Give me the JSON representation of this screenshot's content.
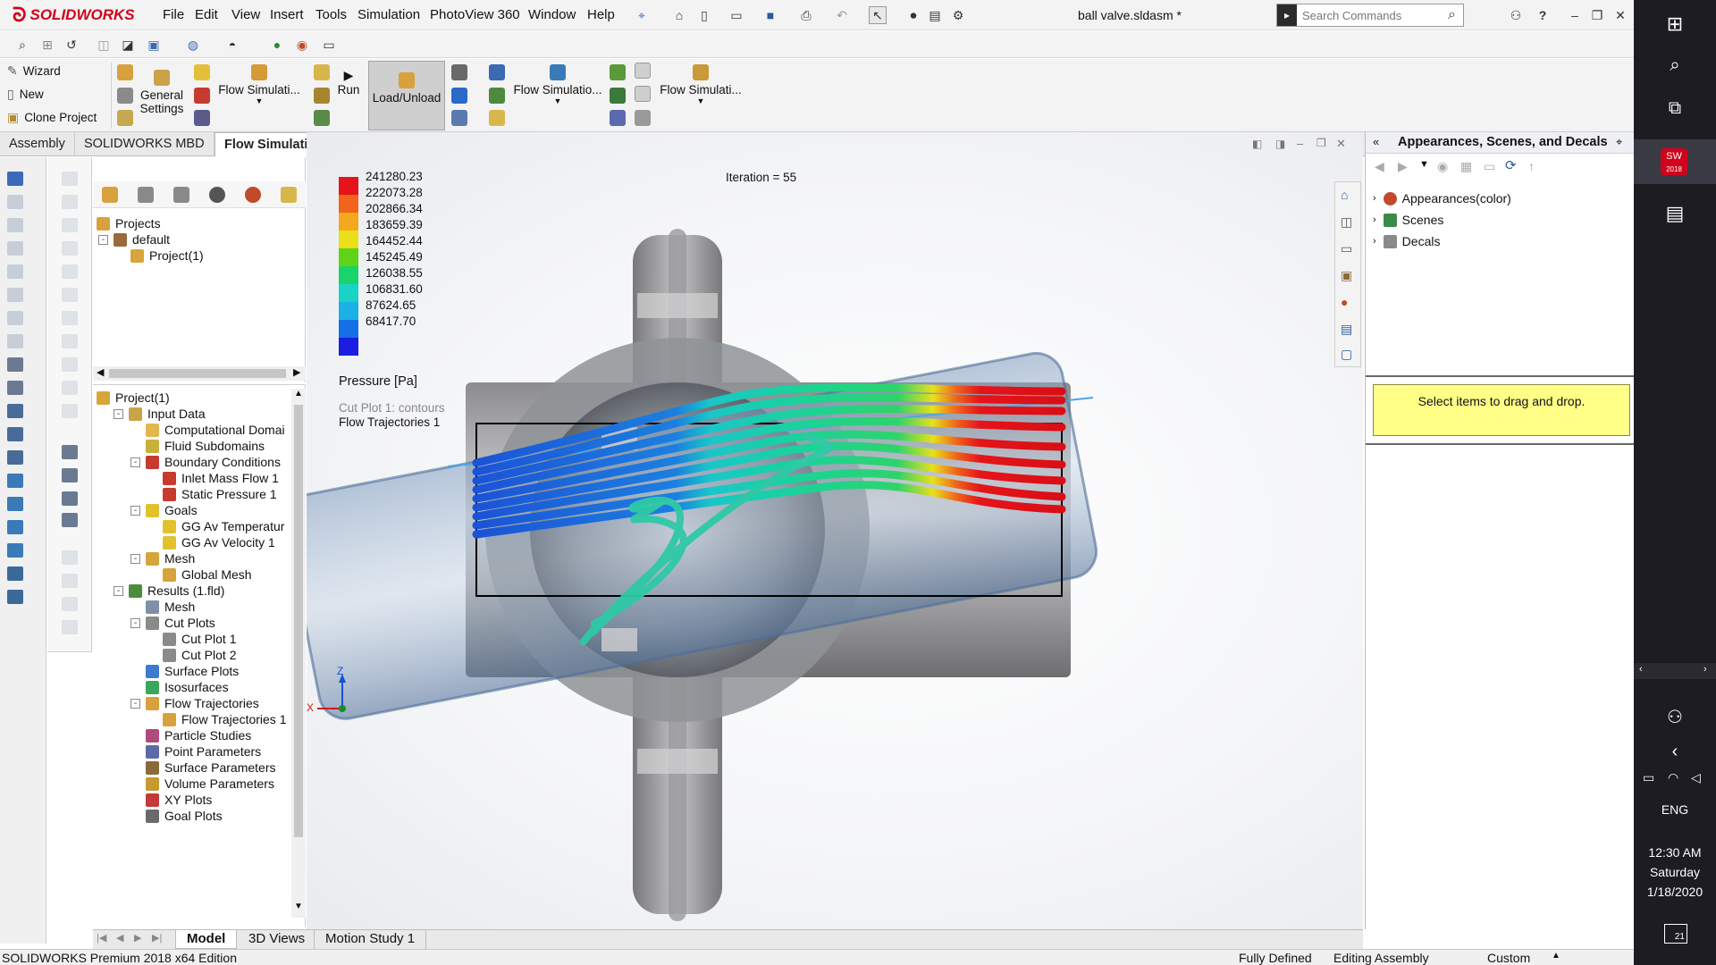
{
  "app": {
    "brand": "SOLIDWORKS",
    "document_title": "ball valve.sldasm *"
  },
  "menu": [
    "File",
    "Edit",
    "View",
    "Insert",
    "Tools",
    "Simulation",
    "PhotoView 360",
    "Window",
    "Help"
  ],
  "search": {
    "placeholder": "Search Commands"
  },
  "command_manager": {
    "wizard": "Wizard",
    "new": "New",
    "clone_project": "Clone Project",
    "general_settings": [
      "General",
      "Settings"
    ],
    "flow_sim_1": "Flow Simulati...",
    "run": "Run",
    "load_unload": "Load/Unload",
    "flow_sim_2": "Flow Simulatio...",
    "flow_sim_3": "Flow Simulati..."
  },
  "tabs": [
    "Assembly",
    "SOLIDWORKS MBD",
    "Flow Simulation"
  ],
  "active_tab": "Flow Simulation",
  "projects_tree": {
    "root": "Projects",
    "config": "default",
    "project": "Project(1)"
  },
  "analysis_tree": [
    {
      "label": "Project(1)",
      "level": 0,
      "exp": "",
      "icon": "#d8a53a"
    },
    {
      "label": "Input Data",
      "level": 1,
      "exp": "-",
      "icon": "#c9a34a"
    },
    {
      "label": "Computational Domai",
      "level": 2,
      "exp": "",
      "icon": "#e3b74d"
    },
    {
      "label": "Fluid Subdomains",
      "level": 2,
      "exp": "",
      "icon": "#c8b13a"
    },
    {
      "label": "Boundary Conditions",
      "level": 2,
      "exp": "-",
      "icon": "#c63b2d"
    },
    {
      "label": "Inlet Mass Flow 1",
      "level": 3,
      "exp": "",
      "icon": "#c63b2d"
    },
    {
      "label": "Static Pressure 1",
      "level": 3,
      "exp": "",
      "icon": "#c63b2d"
    },
    {
      "label": "Goals",
      "level": 2,
      "exp": "-",
      "icon": "#e2c22c"
    },
    {
      "label": "GG Av Temperatur",
      "level": 3,
      "exp": "",
      "icon": "#e2c22c"
    },
    {
      "label": "GG Av Velocity 1",
      "level": 3,
      "exp": "",
      "icon": "#e2c22c"
    },
    {
      "label": "Mesh",
      "level": 2,
      "exp": "-",
      "icon": "#d6a43b"
    },
    {
      "label": "Global Mesh",
      "level": 3,
      "exp": "",
      "icon": "#d6a43b"
    },
    {
      "label": "Results (1.fld)",
      "level": 1,
      "exp": "-",
      "icon": "#4d8c3c"
    },
    {
      "label": "Mesh",
      "level": 2,
      "exp": "",
      "icon": "#7f8fa6"
    },
    {
      "label": "Cut Plots",
      "level": 2,
      "exp": "-",
      "icon": "#8a8a8a"
    },
    {
      "label": "Cut Plot 1",
      "level": 3,
      "exp": "",
      "icon": "#8a8a8a"
    },
    {
      "label": "Cut Plot 2",
      "level": 3,
      "exp": "",
      "icon": "#8a8a8a"
    },
    {
      "label": "Surface Plots",
      "level": 2,
      "exp": "",
      "icon": "#3e7bd0"
    },
    {
      "label": "Isosurfaces",
      "level": 2,
      "exp": "",
      "icon": "#3aa85a"
    },
    {
      "label": "Flow Trajectories",
      "level": 2,
      "exp": "-",
      "icon": "#d9a13e"
    },
    {
      "label": "Flow Trajectories 1",
      "level": 3,
      "exp": "",
      "icon": "#d9a13e"
    },
    {
      "label": "Particle Studies",
      "level": 2,
      "exp": "",
      "icon": "#b04a7a"
    },
    {
      "label": "Point Parameters",
      "level": 2,
      "exp": "",
      "icon": "#5e6aa8"
    },
    {
      "label": "Surface Parameters",
      "level": 2,
      "exp": "",
      "icon": "#8a6a3a"
    },
    {
      "label": "Volume Parameters",
      "level": 2,
      "exp": "",
      "icon": "#c79a2f"
    },
    {
      "label": "XY Plots",
      "level": 2,
      "exp": "",
      "icon": "#c23a3a"
    },
    {
      "label": "Goal Plots",
      "level": 2,
      "exp": "",
      "icon": "#6a6a6a"
    }
  ],
  "viewport": {
    "iteration": "Iteration = 55",
    "legend_values": [
      "241280.23",
      "222073.28",
      "202866.34",
      "183659.39",
      "164452.44",
      "145245.49",
      "126038.55",
      "106831.60",
      "87624.65",
      "68417.70"
    ],
    "legend_colors": [
      "#e5141a",
      "#f0641b",
      "#f4a81e",
      "#e9e01a",
      "#5fd317",
      "#19d36b",
      "#19d3c6",
      "#1bb0e6",
      "#1570e6",
      "#1b1ee0"
    ],
    "legend_title": "Pressure [Pa]",
    "plot_label_1": "Cut Plot 1: contours",
    "plot_label_2": "Flow Trajectories 1",
    "triad_z": "Z",
    "triad_x": "X"
  },
  "task_pane": {
    "title": "Appearances, Scenes, and Decals",
    "items": [
      "Appearances(color)",
      "Scenes",
      "Decals"
    ],
    "drop_hint": "Select items to drag and drop."
  },
  "bottom_tabs": [
    "Model",
    "3D Views",
    "Motion Study 1"
  ],
  "status": {
    "edition": "SOLIDWORKS Premium 2018 x64 Edition",
    "defined": "Fully Defined",
    "mode": "Editing Assembly",
    "units": "Custom"
  },
  "taskbar": {
    "lang": "ENG",
    "time": "12:30 AM",
    "day": "Saturday",
    "date": "1/18/2020",
    "notif_count": "21",
    "sw_badge": "2018"
  }
}
